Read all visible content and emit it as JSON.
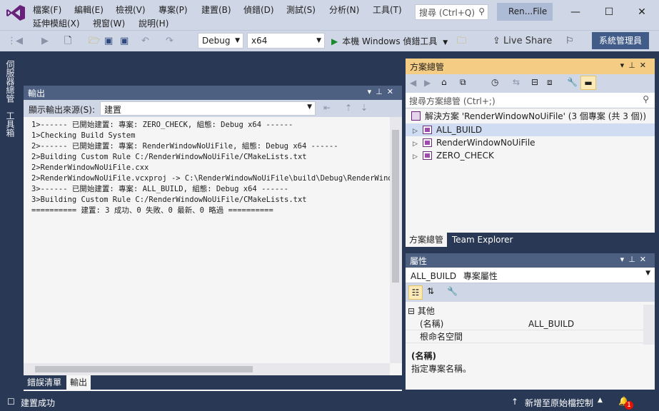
{
  "menu": {
    "row1": [
      "檔案(F)",
      "編輯(E)",
      "檢視(V)",
      "專案(P)",
      "建置(B)",
      "偵錯(D)",
      "測試(S)",
      "分析(N)",
      "工具(T)"
    ],
    "row2": [
      "延伸模組(X)",
      "視窗(W)",
      "說明(H)"
    ]
  },
  "search": {
    "placeholder": "搜尋 (Ctrl+Q)"
  },
  "solution_title": "Ren...File",
  "toolbar": {
    "config": "Debug",
    "platform": "x64",
    "run_label": "本機 Windows 偵錯工具",
    "live_share": "Live Share",
    "admin": "系統管理員"
  },
  "side_tabs": [
    "伺服器總管",
    "工具箱"
  ],
  "output": {
    "title": "輸出",
    "source_label": "顯示輸出來源(S):",
    "source_value": "建置",
    "lines": [
      "1>------ 已開始建置: 專案: ZERO_CHECK, 組態: Debug x64 ------",
      "1>Checking Build System",
      "2>------ 已開始建置: 專案: RenderWindowNoUiFile, 組態: Debug x64 ------",
      "2>Building Custom Rule C:/RenderWindowNoUiFile/CMakeLists.txt",
      "2>RenderWindowNoUiFile.cxx",
      "2>RenderWindowNoUiFile.vcxproj -> C:\\RenderWindowNoUiFile\\build\\Debug\\RenderWindowN",
      "3>------ 已開始建置: 專案: ALL_BUILD, 組態: Debug x64 ------",
      "3>Building Custom Rule C:/RenderWindowNoUiFile/CMakeLists.txt",
      "========== 建置: 3 成功、0 失敗、0 最新、0 略過 =========="
    ]
  },
  "bottom_tabs": {
    "error_list": "錯誤清單",
    "output": "輸出"
  },
  "solution_explorer": {
    "title": "方案總管",
    "search_placeholder": "搜尋方案總管 (Ctrl+;)",
    "solution_node": "解決方案 'RenderWindowNoUiFile' (3 個專案 (共 3 個))",
    "projects": [
      "ALL_BUILD",
      "RenderWindowNoUiFile",
      "ZERO_CHECK"
    ],
    "tabs": [
      "方案總管",
      "Team Explorer"
    ]
  },
  "properties": {
    "title": "屬性",
    "object": "ALL_BUILD",
    "object_type": "專案屬性",
    "category": "其他",
    "rows": [
      {
        "name": "(名稱)",
        "value": "ALL_BUILD"
      },
      {
        "name": "根命名空間",
        "value": ""
      }
    ],
    "desc_title": "(名稱)",
    "desc_text": "指定專案名稱。"
  },
  "status": {
    "message": "建置成功",
    "source_control": "新增至原始檔控制",
    "notifications": "1"
  },
  "colors": {
    "accent_blue": "#293955",
    "panel_head": "#4d6082",
    "active_head": "#f5cc84",
    "vs_purple": "#68217a"
  }
}
